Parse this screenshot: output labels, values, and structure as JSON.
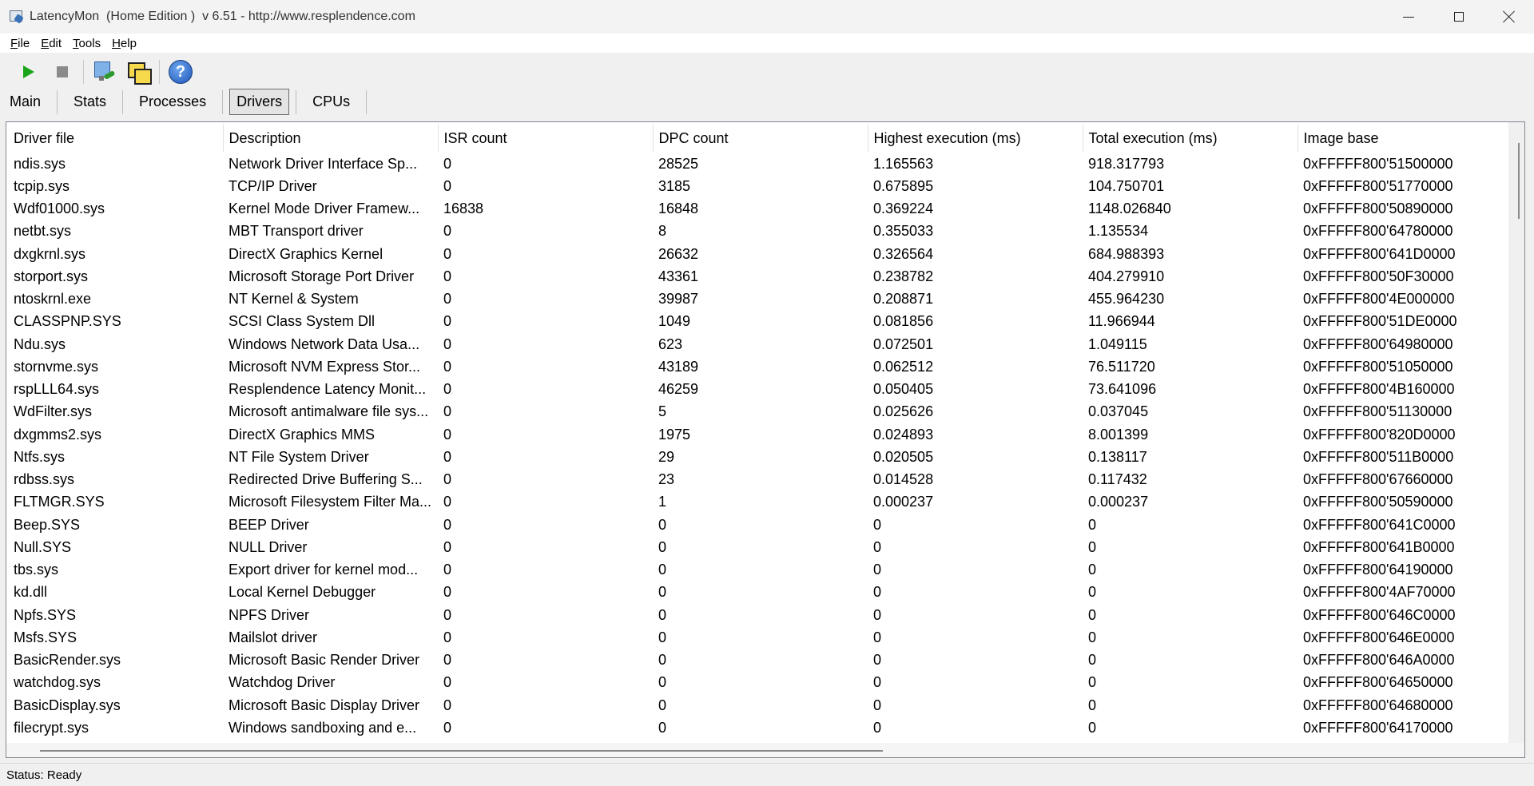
{
  "window": {
    "title": "LatencyMon  (Home Edition )  v 6.51 - http://www.resplendence.com"
  },
  "menu": [
    {
      "accel": "F",
      "rest": "ile"
    },
    {
      "accel": "E",
      "rest": "dit"
    },
    {
      "accel": "T",
      "rest": "ools"
    },
    {
      "accel": "H",
      "rest": "elp"
    }
  ],
  "toolbar": {
    "icons": [
      "play-icon",
      "stop-icon",
      "process-icon",
      "windows-icon",
      "help-icon"
    ],
    "help_glyph": "?"
  },
  "tabs": [
    {
      "label": "Main",
      "active": false
    },
    {
      "label": "Stats",
      "active": false
    },
    {
      "label": "Processes",
      "active": false
    },
    {
      "label": "Drivers",
      "active": true
    },
    {
      "label": "CPUs",
      "active": false
    }
  ],
  "drivers": {
    "columns": [
      "Driver file",
      "Description",
      "ISR count",
      "DPC count",
      "Highest execution (ms)",
      "Total execution (ms)",
      "Image base"
    ],
    "rows": [
      [
        "ndis.sys",
        "Network Driver Interface Sp...",
        "0",
        "28525",
        "1.165563",
        "918.317793",
        "0xFFFFF800'51500000"
      ],
      [
        "tcpip.sys",
        "TCP/IP Driver",
        "0",
        "3185",
        "0.675895",
        "104.750701",
        "0xFFFFF800'51770000"
      ],
      [
        "Wdf01000.sys",
        "Kernel Mode Driver Framew...",
        "16838",
        "16848",
        "0.369224",
        "1148.026840",
        "0xFFFFF800'50890000"
      ],
      [
        "netbt.sys",
        "MBT Transport driver",
        "0",
        "8",
        "0.355033",
        "1.135534",
        "0xFFFFF800'64780000"
      ],
      [
        "dxgkrnl.sys",
        "DirectX Graphics Kernel",
        "0",
        "26632",
        "0.326564",
        "684.988393",
        "0xFFFFF800'641D0000"
      ],
      [
        "storport.sys",
        "Microsoft Storage Port Driver",
        "0",
        "43361",
        "0.238782",
        "404.279910",
        "0xFFFFF800'50F30000"
      ],
      [
        "ntoskrnl.exe",
        "NT Kernel & System",
        "0",
        "39987",
        "0.208871",
        "455.964230",
        "0xFFFFF800'4E000000"
      ],
      [
        "CLASSPNP.SYS",
        "SCSI Class System Dll",
        "0",
        "1049",
        "0.081856",
        "11.966944",
        "0xFFFFF800'51DE0000"
      ],
      [
        "Ndu.sys",
        "Windows Network Data Usa...",
        "0",
        "623",
        "0.072501",
        "1.049115",
        "0xFFFFF800'64980000"
      ],
      [
        "stornvme.sys",
        "Microsoft NVM Express Stor...",
        "0",
        "43189",
        "0.062512",
        "76.511720",
        "0xFFFFF800'51050000"
      ],
      [
        "rspLLL64.sys",
        "Resplendence Latency Monit...",
        "0",
        "46259",
        "0.050405",
        "73.641096",
        "0xFFFFF800'4B160000"
      ],
      [
        "WdFilter.sys",
        "Microsoft antimalware file sys...",
        "0",
        "5",
        "0.025626",
        "0.037045",
        "0xFFFFF800'51130000"
      ],
      [
        "dxgmms2.sys",
        "DirectX Graphics MMS",
        "0",
        "1975",
        "0.024893",
        "8.001399",
        "0xFFFFF800'820D0000"
      ],
      [
        "Ntfs.sys",
        "NT File System Driver",
        "0",
        "29",
        "0.020505",
        "0.138117",
        "0xFFFFF800'511B0000"
      ],
      [
        "rdbss.sys",
        "Redirected Drive Buffering S...",
        "0",
        "23",
        "0.014528",
        "0.117432",
        "0xFFFFF800'67660000"
      ],
      [
        "FLTMGR.SYS",
        "Microsoft Filesystem Filter Ma...",
        "0",
        "1",
        "0.000237",
        "0.000237",
        "0xFFFFF800'50590000"
      ],
      [
        "Beep.SYS",
        "BEEP Driver",
        "0",
        "0",
        "0",
        "0",
        "0xFFFFF800'641C0000"
      ],
      [
        "Null.SYS",
        "NULL Driver",
        "0",
        "0",
        "0",
        "0",
        "0xFFFFF800'641B0000"
      ],
      [
        "tbs.sys",
        "Export driver for kernel mod...",
        "0",
        "0",
        "0",
        "0",
        "0xFFFFF800'64190000"
      ],
      [
        "kd.dll",
        "Local Kernel Debugger",
        "0",
        "0",
        "0",
        "0",
        "0xFFFFF800'4AF70000"
      ],
      [
        "Npfs.SYS",
        "NPFS Driver",
        "0",
        "0",
        "0",
        "0",
        "0xFFFFF800'646C0000"
      ],
      [
        "Msfs.SYS",
        "Mailslot driver",
        "0",
        "0",
        "0",
        "0",
        "0xFFFFF800'646E0000"
      ],
      [
        "BasicRender.sys",
        "Microsoft Basic Render Driver",
        "0",
        "0",
        "0",
        "0",
        "0xFFFFF800'646A0000"
      ],
      [
        "watchdog.sys",
        "Watchdog Driver",
        "0",
        "0",
        "0",
        "0",
        "0xFFFFF800'64650000"
      ],
      [
        "BasicDisplay.sys",
        "Microsoft Basic Display Driver",
        "0",
        "0",
        "0",
        "0",
        "0xFFFFF800'64680000"
      ],
      [
        "filecrypt.sys",
        "Windows sandboxing and e...",
        "0",
        "0",
        "0",
        "0",
        "0xFFFFF800'64170000"
      ]
    ]
  },
  "status": {
    "text": "Status: Ready"
  }
}
